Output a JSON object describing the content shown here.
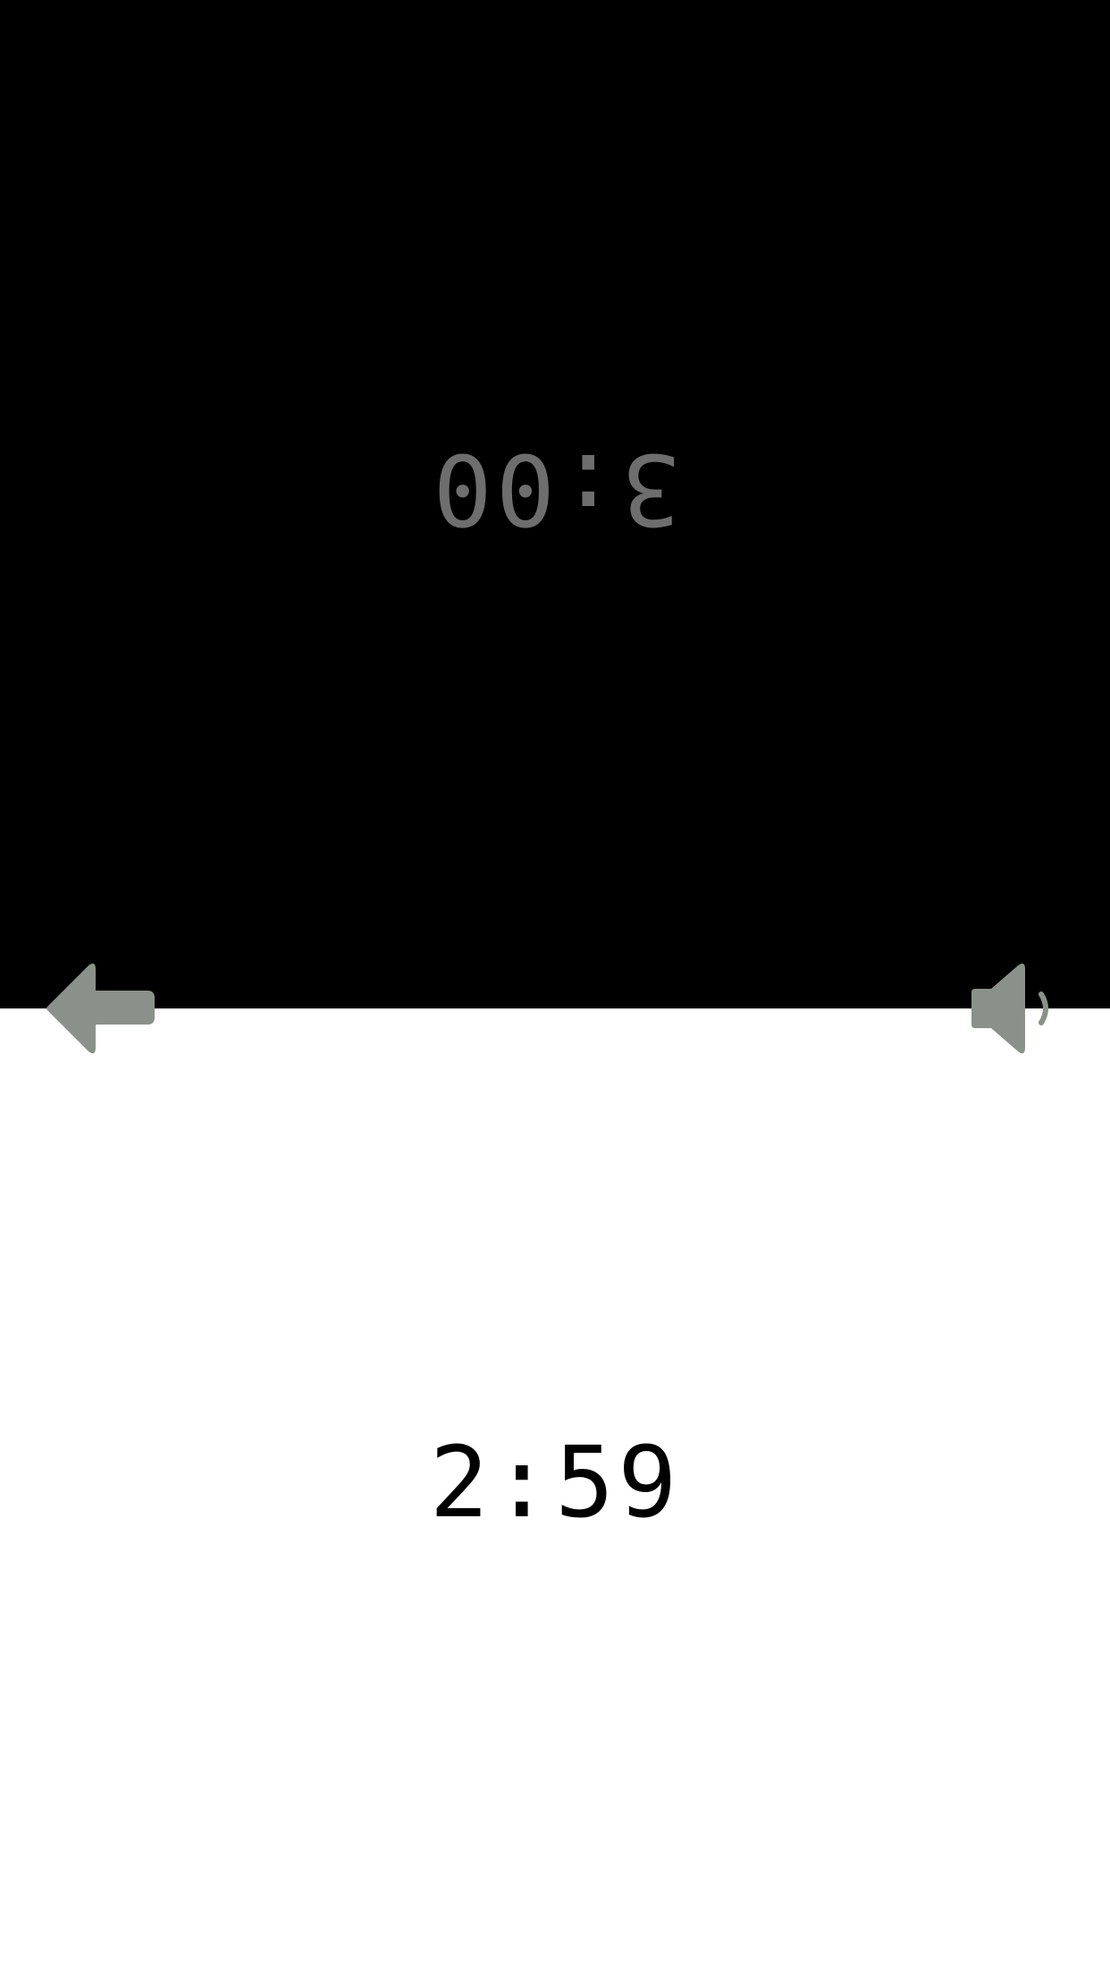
{
  "players": {
    "top": {
      "time": "3:00"
    },
    "bottom": {
      "time": "2:59"
    }
  },
  "controls": {
    "back_icon": "arrow-left-icon",
    "sound_icon": "speaker-volume-icon"
  },
  "colors": {
    "top_background": "#000000",
    "bottom_background": "#ffffff",
    "inactive_time": "#6e6e6e",
    "active_time": "#000000",
    "icon_fill": "#8a918a"
  }
}
